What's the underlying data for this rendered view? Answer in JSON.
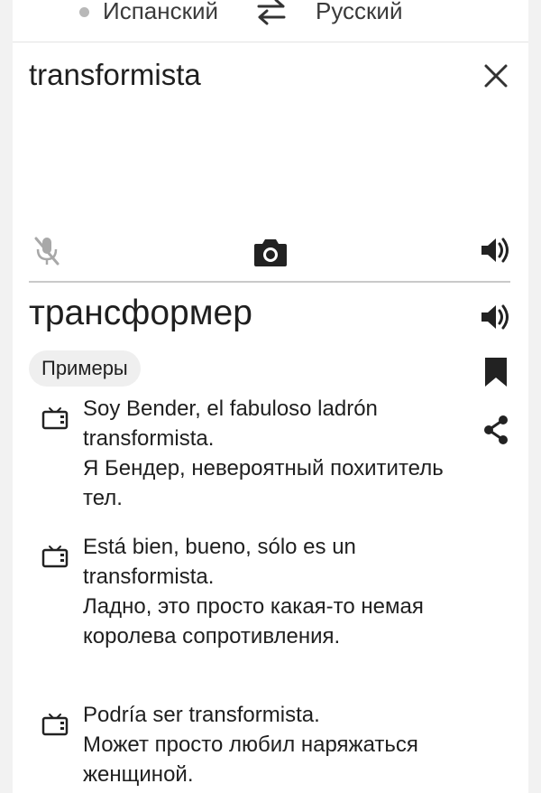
{
  "language_bar": {
    "source_language": "Испанский",
    "target_language": "Русский"
  },
  "input": {
    "text": "transformista"
  },
  "result": {
    "translation": "трансформер",
    "examples_label": "Примеры"
  },
  "examples": [
    {
      "source": "Soy Bender, el fabuloso ladrón transformista.",
      "target": "Я Бендер, невероятный похититель тел."
    },
    {
      "source": "Está bien, bueno, sólo es un transformista.",
      "target": "Ладно, это просто какая-то немая королева сопротивления."
    },
    {
      "source": "Podría ser transformista.",
      "target": "Может просто любил наряжаться женщиной."
    }
  ],
  "icons": {
    "status_dot": "dot-icon",
    "swap": "swap-languages-icon",
    "close": "close-icon",
    "microphone": "mic-off-icon",
    "camera": "camera-icon",
    "speaker": "speaker-icon",
    "bookmark": "bookmark-icon",
    "share": "share-icon",
    "example_source": "tv-icon"
  }
}
